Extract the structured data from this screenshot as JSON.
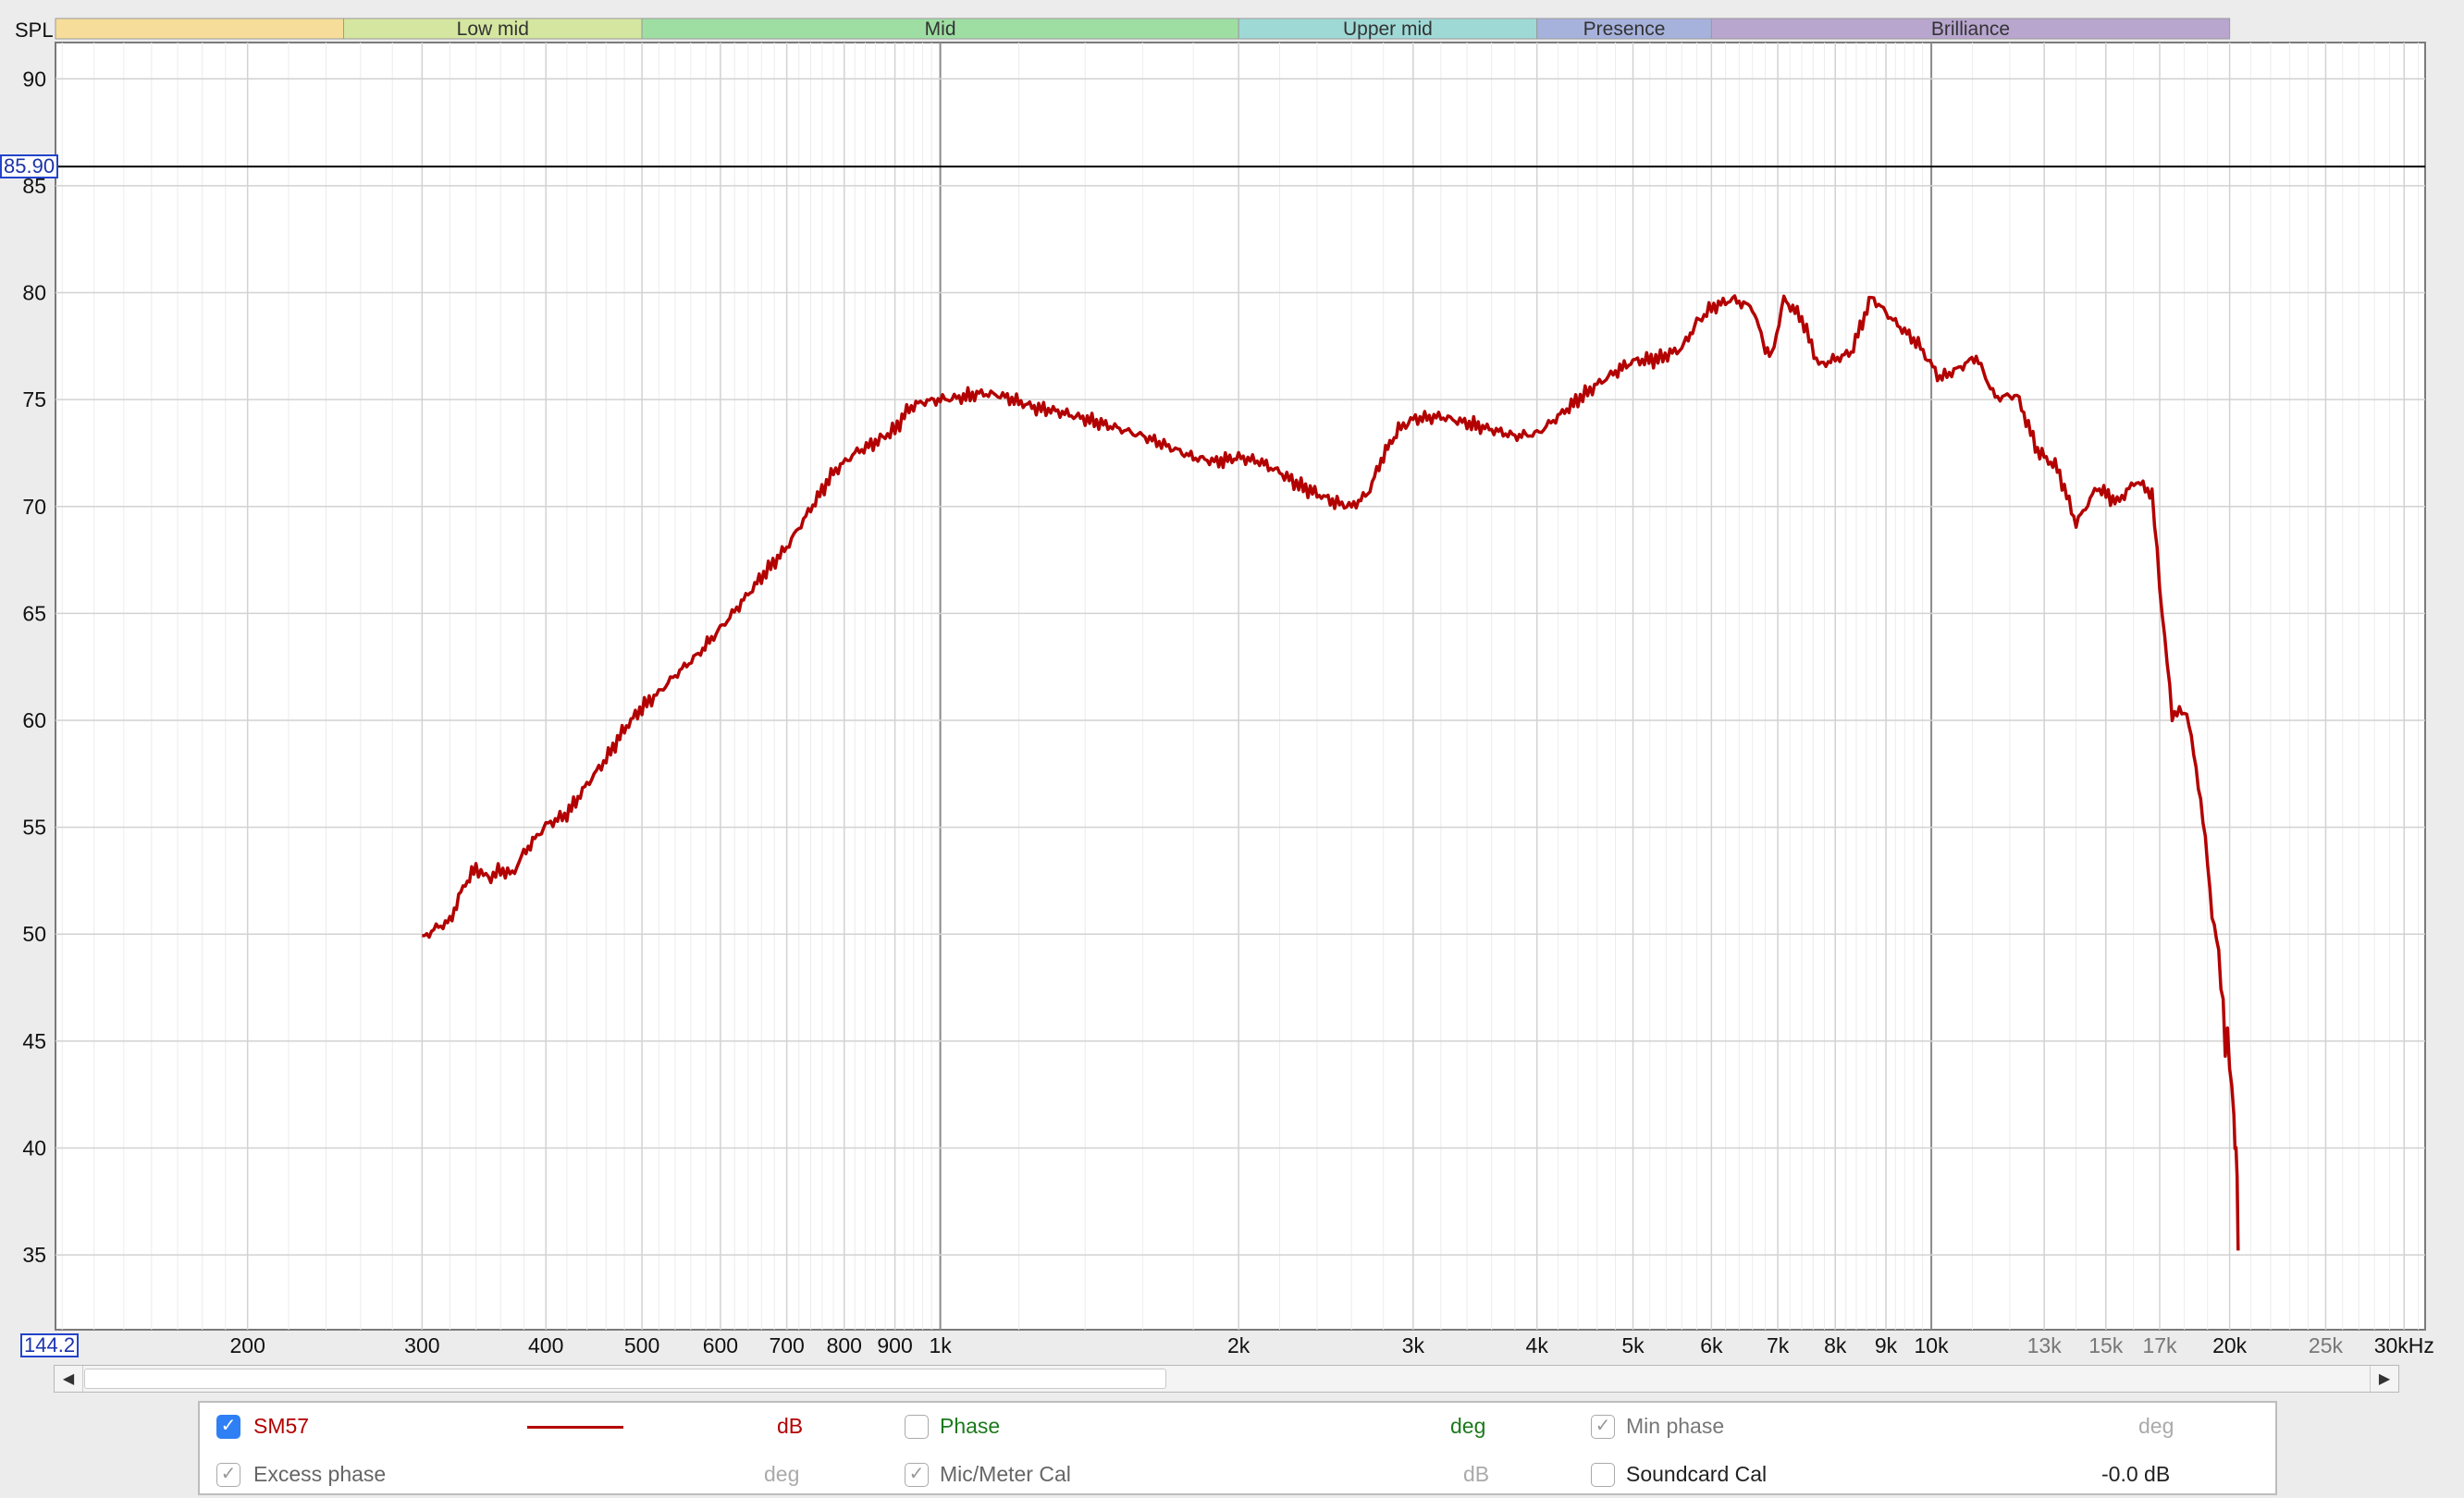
{
  "chart_data": {
    "type": "line",
    "x_scale": "log",
    "x_unit": "Hz",
    "y_label": "SPL",
    "xlim": [
      128,
      31500
    ],
    "ylim": [
      31.5,
      91.7
    ],
    "y_ticks": [
      35,
      40,
      45,
      50,
      55,
      60,
      65,
      70,
      75,
      80,
      85,
      90
    ],
    "x_ticks": [
      {
        "f": 200,
        "label": "200"
      },
      {
        "f": 300,
        "label": "300"
      },
      {
        "f": 400,
        "label": "400"
      },
      {
        "f": 500,
        "label": "500"
      },
      {
        "f": 600,
        "label": "600"
      },
      {
        "f": 700,
        "label": "700"
      },
      {
        "f": 800,
        "label": "800"
      },
      {
        "f": 900,
        "label": "900"
      },
      {
        "f": 1000,
        "label": "1k"
      },
      {
        "f": 2000,
        "label": "2k"
      },
      {
        "f": 3000,
        "label": "3k"
      },
      {
        "f": 4000,
        "label": "4k"
      },
      {
        "f": 5000,
        "label": "5k"
      },
      {
        "f": 6000,
        "label": "6k"
      },
      {
        "f": 7000,
        "label": "7k"
      },
      {
        "f": 8000,
        "label": "8k"
      },
      {
        "f": 9000,
        "label": "9k"
      },
      {
        "f": 10000,
        "label": "10k"
      },
      {
        "f": 13000,
        "label": "13k",
        "faint": true
      },
      {
        "f": 15000,
        "label": "15k",
        "faint": true
      },
      {
        "f": 17000,
        "label": "17k",
        "faint": true
      },
      {
        "f": 20000,
        "label": "20k"
      },
      {
        "f": 25000,
        "label": "25k",
        "faint": true
      },
      {
        "f": 30000,
        "label": "30kHz"
      }
    ],
    "bands": [
      {
        "name": "",
        "from": 128,
        "to": 250,
        "color": "#f7dd9a"
      },
      {
        "name": "Low mid",
        "from": 250,
        "to": 500,
        "color": "#d5e6a0"
      },
      {
        "name": "Mid",
        "from": 500,
        "to": 2000,
        "color": "#9fdea3"
      },
      {
        "name": "Upper mid",
        "from": 2000,
        "to": 4000,
        "color": "#9fd9d6"
      },
      {
        "name": "Presence",
        "from": 4000,
        "to": 6000,
        "color": "#a7b2dc"
      },
      {
        "name": "Brilliance",
        "from": 6000,
        "to": 20000,
        "color": "#b8a6cf"
      }
    ],
    "cursor_y": 85.9,
    "cursor_y_label": "85.90",
    "cursor_x_label": "144.2",
    "series": [
      {
        "name": "SM57",
        "color": "#b30000",
        "points": [
          [
            300,
            49.8
          ],
          [
            310,
            50.3
          ],
          [
            320,
            50.6
          ],
          [
            330,
            52.2
          ],
          [
            340,
            53.1
          ],
          [
            350,
            52.6
          ],
          [
            360,
            53.0
          ],
          [
            370,
            52.8
          ],
          [
            380,
            53.8
          ],
          [
            400,
            55.1
          ],
          [
            420,
            55.6
          ],
          [
            440,
            57.0
          ],
          [
            460,
            58.2
          ],
          [
            480,
            59.6
          ],
          [
            500,
            60.6
          ],
          [
            520,
            61.3
          ],
          [
            540,
            62.1
          ],
          [
            570,
            63.1
          ],
          [
            600,
            64.3
          ],
          [
            630,
            65.5
          ],
          [
            660,
            66.7
          ],
          [
            700,
            68.1
          ],
          [
            740,
            69.9
          ],
          [
            780,
            71.6
          ],
          [
            820,
            72.5
          ],
          [
            860,
            73.0
          ],
          [
            900,
            73.6
          ],
          [
            930,
            74.6
          ],
          [
            960,
            74.9
          ],
          [
            1000,
            75.0
          ],
          [
            1050,
            75.1
          ],
          [
            1100,
            75.3
          ],
          [
            1150,
            75.2
          ],
          [
            1200,
            74.9
          ],
          [
            1250,
            74.6
          ],
          [
            1300,
            74.5
          ],
          [
            1400,
            74.1
          ],
          [
            1500,
            73.7
          ],
          [
            1600,
            73.3
          ],
          [
            1700,
            72.8
          ],
          [
            1800,
            72.3
          ],
          [
            1900,
            72.1
          ],
          [
            2000,
            72.3
          ],
          [
            2100,
            72.1
          ],
          [
            2200,
            71.6
          ],
          [
            2300,
            71.0
          ],
          [
            2400,
            70.6
          ],
          [
            2500,
            70.2
          ],
          [
            2600,
            70.0
          ],
          [
            2700,
            70.6
          ],
          [
            2800,
            72.4
          ],
          [
            2900,
            73.6
          ],
          [
            3000,
            74.1
          ],
          [
            3200,
            74.2
          ],
          [
            3400,
            73.9
          ],
          [
            3600,
            73.6
          ],
          [
            3800,
            73.3
          ],
          [
            4000,
            73.4
          ],
          [
            4200,
            74.2
          ],
          [
            4400,
            75.0
          ],
          [
            4600,
            75.7
          ],
          [
            4800,
            76.3
          ],
          [
            5000,
            76.8
          ],
          [
            5300,
            76.9
          ],
          [
            5600,
            77.4
          ],
          [
            5800,
            78.6
          ],
          [
            6000,
            79.3
          ],
          [
            6300,
            79.7
          ],
          [
            6600,
            79.3
          ],
          [
            6800,
            77.4
          ],
          [
            6900,
            77.0
          ],
          [
            7100,
            79.7
          ],
          [
            7400,
            78.8
          ],
          [
            7700,
            76.6
          ],
          [
            8000,
            76.9
          ],
          [
            8300,
            77.2
          ],
          [
            8700,
            79.8
          ],
          [
            9200,
            78.6
          ],
          [
            9700,
            77.6
          ],
          [
            10200,
            76.0
          ],
          [
            10600,
            76.4
          ],
          [
            11100,
            77.0
          ],
          [
            11600,
            75.1
          ],
          [
            12200,
            75.2
          ],
          [
            12800,
            72.6
          ],
          [
            13400,
            71.8
          ],
          [
            14000,
            69.2
          ],
          [
            14700,
            70.9
          ],
          [
            15400,
            70.2
          ],
          [
            16100,
            71.2
          ],
          [
            16700,
            70.6
          ],
          [
            17100,
            65.0
          ],
          [
            17500,
            60.3
          ],
          [
            18100,
            60.4
          ],
          [
            18600,
            57.1
          ],
          [
            19000,
            53.4
          ],
          [
            19300,
            50.1
          ],
          [
            19600,
            48.2
          ],
          [
            19800,
            45.2
          ],
          [
            20000,
            43.8
          ],
          [
            20200,
            41.8
          ],
          [
            20300,
            40.5
          ],
          [
            20400,
            35.2
          ]
        ]
      }
    ]
  },
  "legend": {
    "measurement_name": "SM57",
    "measurement_unit": "dB",
    "phase_label": "Phase",
    "phase_unit": "deg",
    "min_phase_label": "Min phase",
    "min_phase_unit": "deg",
    "excess_phase_label": "Excess phase",
    "excess_phase_unit": "deg",
    "mic_cal_label": "Mic/Meter Cal",
    "mic_cal_unit": "dB",
    "soundcard_cal_label": "Soundcard Cal",
    "soundcard_cal_value": "-0.0 dB",
    "colors": {
      "measurement": "#b30000",
      "phase": "#1b7a1b",
      "muted": "#999999"
    }
  }
}
